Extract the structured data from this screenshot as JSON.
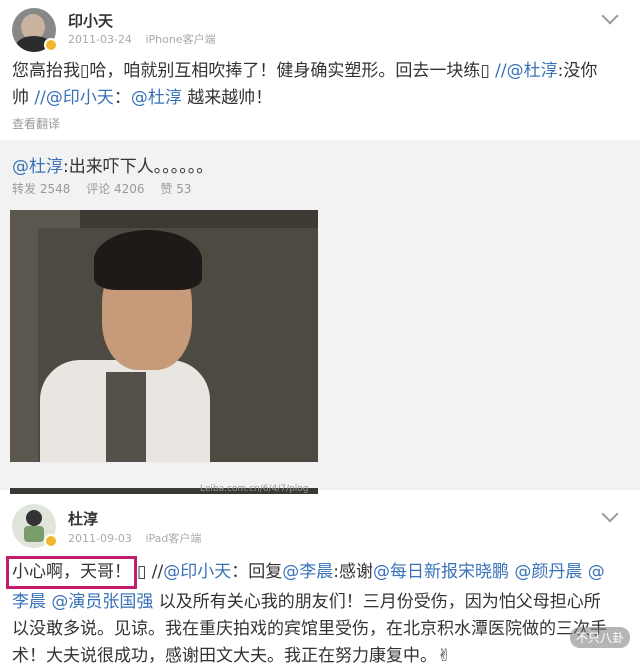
{
  "post1": {
    "name": "印小天",
    "date": "2011-03-24",
    "client": "iPhone客户端",
    "line1_a": "您高抬我",
    "line1_b": "哈，咱就别互相吹捧了！健身确实塑形。回去一块练",
    "line1_mention": "//@杜淳",
    "line1_c": ":没你",
    "line2_a": "帅 ",
    "line2_mention1": "//@印小天",
    "line2_b": "：",
    "line2_mention2": "@杜淳",
    "line2_c": " 越来越帅！",
    "translate": "查看翻译"
  },
  "repost": {
    "mention": "@杜淳",
    "text": ":出来吓下人。。。。。。",
    "reposts": "转发 2548",
    "comments": "评论 4206",
    "likes": "赞 53",
    "photo_watermark": "Leiba.com.cn/6/4/7/plog"
  },
  "post2": {
    "name": "杜淳",
    "date": "2011-09-03",
    "client": "iPad客户端",
    "highlight": "小心啊，天哥！",
    "line1_sep": " //",
    "line1_mention": "@印小天",
    "line1_a": "：回复",
    "line1_mention2": "@李晨",
    "line1_b": ":感谢",
    "line1_mention3": "@每日新报宋晓鹏",
    "line1_mention4": "@颜丹晨",
    "line1_mention5": "@",
    "line2_mention1": "李晨",
    "line2_mention2": "@演员张国强",
    "line2_a": " 以及所有关心我的朋友们！三月份受伤，因为怕父母担心所",
    "line3": "以没敢多说。见谅。我在重庆拍戏的宾馆里受伤，在北京积水潭医院做的三次手",
    "line4": "术！大夫说很成功，感谢田文大夫。我正在努力康复中。✌"
  },
  "watermark": "不只八卦",
  "colors": {
    "link": "#3a72b8",
    "highlight_border": "#c21d6b",
    "repost_bg": "#f2f2f2"
  }
}
